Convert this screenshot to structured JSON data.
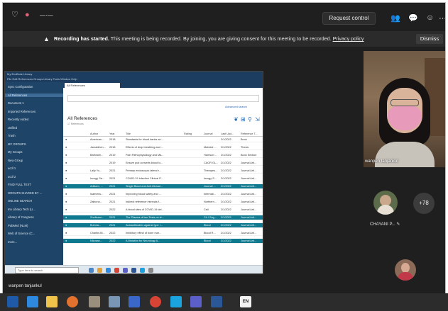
{
  "topbar": {
    "request_control": "Request control"
  },
  "banner": {
    "bold": "Recording has started.",
    "message": " This meeting is being recorded. By joining, you are giving consent for this meeting to be recorded.",
    "link": "Privacy policy",
    "dismiss": "Dismiss"
  },
  "shared_app": {
    "title": "My EndNote Library",
    "menu": "File  Edit  References  Groups  Library  Tools  Window  Help",
    "sidebar": [
      {
        "label": "Sync Configuration",
        "selected": false
      },
      {
        "label": "All References",
        "selected": true
      },
      {
        "label": "Document 1",
        "selected": false
      },
      {
        "label": "Imported References",
        "selected": false
      },
      {
        "label": "Recently Added",
        "selected": false
      },
      {
        "label": "Unfiled",
        "selected": false
      },
      {
        "label": "Trash",
        "selected": false
      },
      {
        "label": "MY GROUPS",
        "selected": false
      },
      {
        "label": "My Groups",
        "selected": false
      },
      {
        "label": "New Group",
        "selected": false
      },
      {
        "label": "ucdl 1",
        "selected": false
      },
      {
        "label": "ucdl 2",
        "selected": false
      },
      {
        "label": "FIND FULL TEXT",
        "selected": false
      },
      {
        "label": "GROUPS SHARED BY ...",
        "selected": false
      },
      {
        "label": "ONLINE SEARCH",
        "selected": false
      },
      {
        "label": "Inn Library Tech (U...",
        "selected": false
      },
      {
        "label": "Library of Congress",
        "selected": false
      },
      {
        "label": "PubMed (NLM)",
        "selected": false
      },
      {
        "label": "Web of Science (C...",
        "selected": false
      },
      {
        "label": "more...",
        "selected": false
      }
    ],
    "tab": "All References",
    "advanced_search": "Advanced search",
    "library_title": "All References",
    "library_sub": "17 References",
    "columns": [
      "",
      "",
      "Author",
      "Year",
      "Title",
      "Rating",
      "Journal",
      "Last Upd...",
      "Reference T..."
    ],
    "rows": [
      {
        "author": "American ...",
        "year": "2018",
        "title": "Standards for blood banks an...",
        "journal": "",
        "updated": "2/1/2022",
        "type": "Book",
        "hl": false
      },
      {
        "author": "Jamaldhen...",
        "year": "2018",
        "title": "Effects of drop breathing and ...",
        "journal": "Mahidol ...",
        "updated": "2/1/2022",
        "type": "Thesis",
        "hl": false
      },
      {
        "author": "Bathroeli...",
        "year": "2019",
        "title": "Pain Pathophysiology and Ma...",
        "journal": "Harrison'...",
        "updated": "2/1/2022",
        "type": "Book Section",
        "hl": false
      },
      {
        "author": "",
        "year": "2019",
        "title": "Ensure pub converts blood lo...",
        "journal": "CAGR GL...",
        "updated": "2/1/2022",
        "type": "Journal Arti...",
        "hl": false
      },
      {
        "author": "Lally Yu...",
        "year": "2021",
        "title": "Primary endoscopic lateral r...",
        "journal": "Therapeu...",
        "updated": "2/1/2022",
        "type": "Journal Arti...",
        "hl": false
      },
      {
        "author": "Iocugy Sa...",
        "year": "2021",
        "title": "COVID-19 Infection Clinical P...",
        "journal": "Iocugy S...",
        "updated": "2/1/2022",
        "type": "Journal Arti...",
        "hl": false
      },
      {
        "author": "Adikam, ...",
        "year": "2021",
        "title": "Single Blood and Anti-Mutual...",
        "journal": "Journal ...",
        "updated": "2/1/2022",
        "type": "Journal Arti...",
        "hl": true
      },
      {
        "author": "Isaevess...",
        "year": "2021",
        "title": "Improving blood safety and ...",
        "journal": "Internati...",
        "updated": "2/1/2022",
        "type": "Journal Arti...",
        "hl": false
      },
      {
        "author": "Zablono...",
        "year": "2021",
        "title": "Indirect reference intervals f...",
        "journal": "Northern...",
        "updated": "2/1/2022",
        "type": "Journal Arti...",
        "hl": false
      },
      {
        "author": "",
        "year": "2022",
        "title": "A blood sites of COVID-19 del...",
        "journal": "Cell",
        "updated": "2/1/2022",
        "type": "Journal Arti...",
        "hl": false
      },
      {
        "author": "Snellman...",
        "year": "2021",
        "title": "The Plasma of two Tests on st...",
        "journal": "Ch / Sug...",
        "updated": "2/1/2022",
        "type": "Journal Arti...",
        "hl": true
      },
      {
        "author": "Buhnia...",
        "year": "2021",
        "title": "Autoantibodies against type I...",
        "journal": "Blood",
        "updated": "2/1/2022",
        "type": "Journal Arti...",
        "hl": true
      },
      {
        "author": "Charite-Mi...",
        "year": "2022",
        "title": "Inhibitory effect of bone mar...",
        "journal": "Blood R...",
        "updated": "2/1/2022",
        "type": "Journal Arti...",
        "hl": false
      },
      {
        "author": "Nikosan...",
        "year": "2022",
        "title": "A Mutation for Neurology A...",
        "journal": "Blood",
        "updated": "2/1/2022",
        "type": "Journal Arti...",
        "hl": true
      }
    ],
    "taskbar_search": "Type here to search"
  },
  "participants": {
    "main_name": "wanpen tanjankul",
    "tile_name": "CHAYANI P...",
    "more_count": "+78",
    "bottom_name": "wanpen tanjankul"
  },
  "windows_taskbar": {
    "lang": "EN"
  }
}
